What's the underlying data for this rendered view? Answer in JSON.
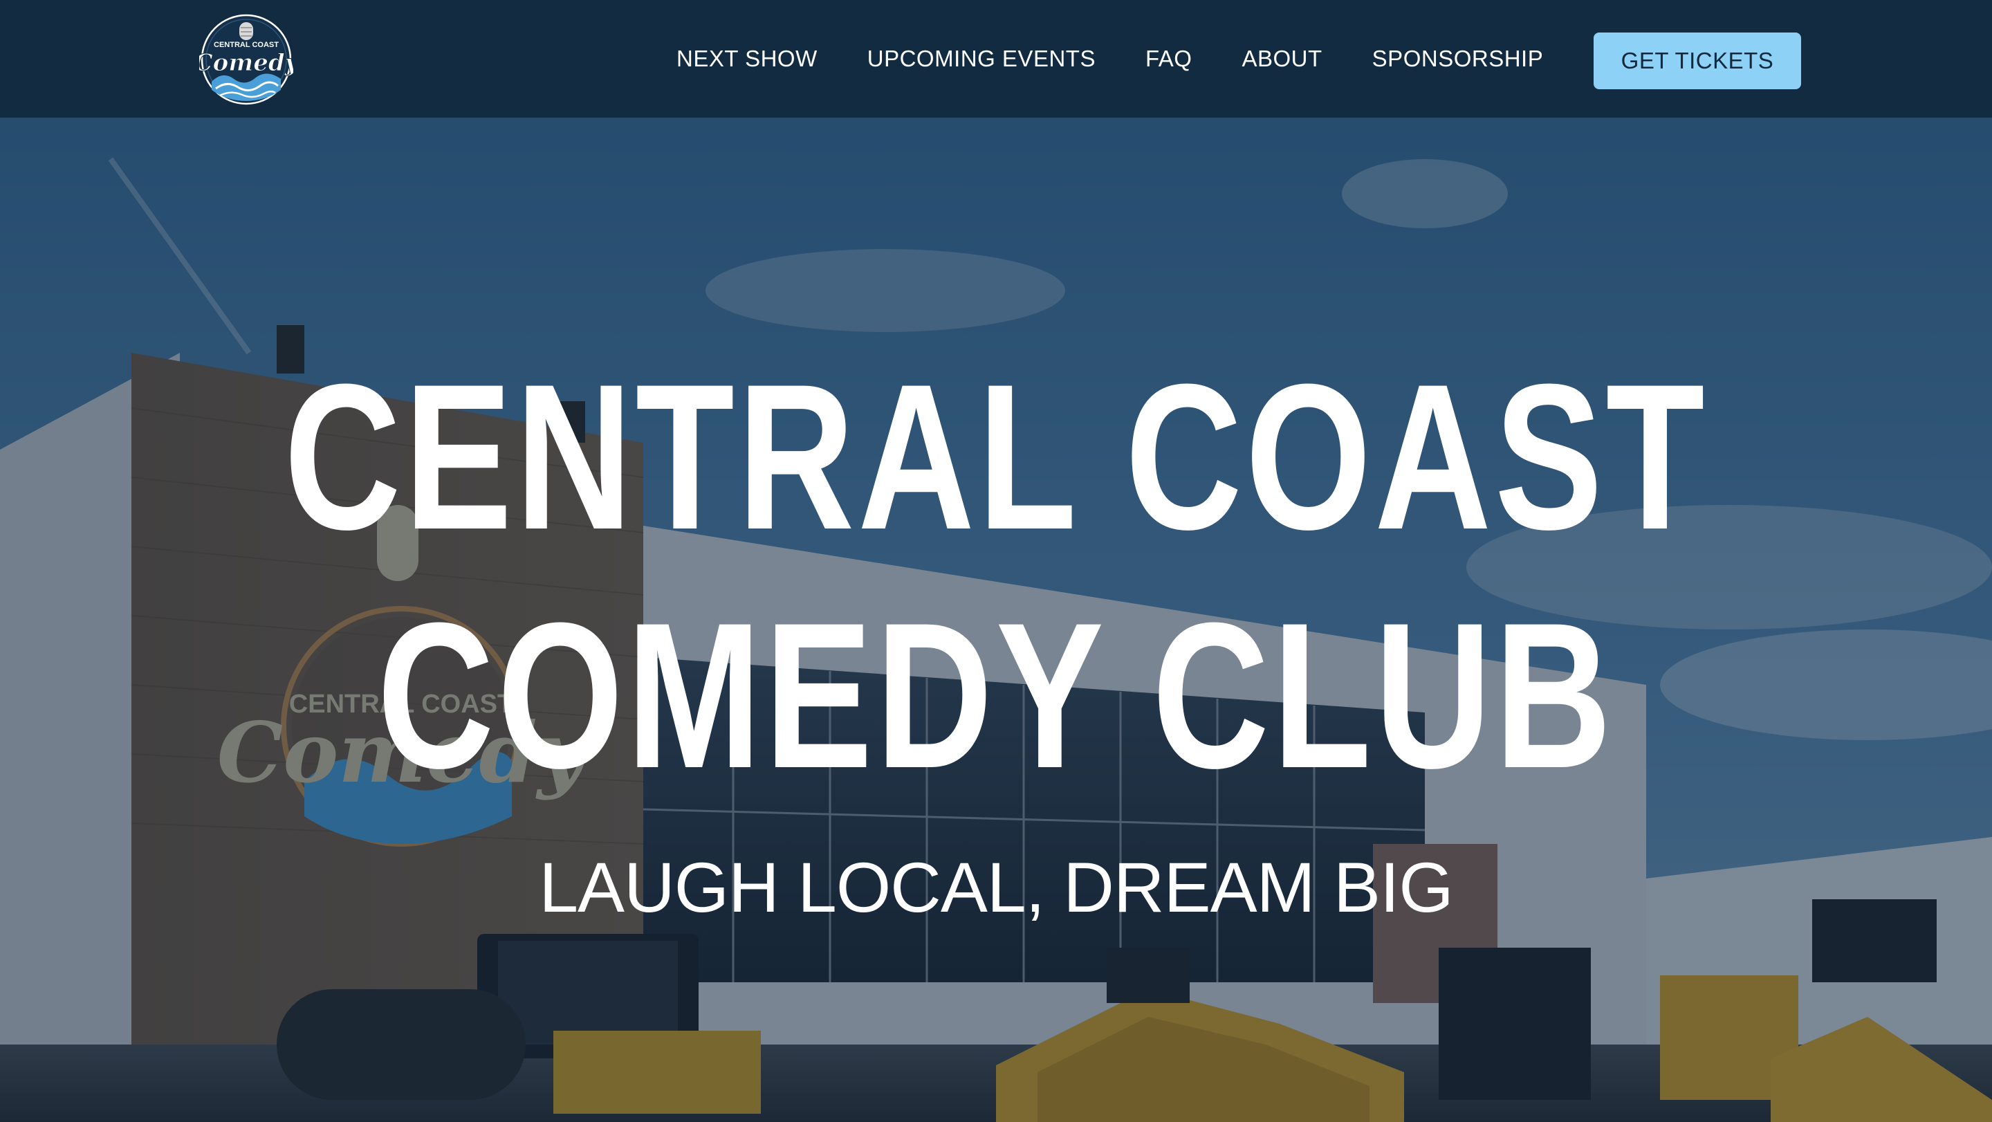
{
  "nav": {
    "logo": {
      "text_top": "CENTRAL COAST",
      "text_main": "Comedy",
      "icon": "microphone-wave-icon"
    },
    "links": [
      {
        "label": "NEXT SHOW"
      },
      {
        "label": "UPCOMING EVENTS"
      },
      {
        "label": "FAQ"
      },
      {
        "label": "ABOUT"
      },
      {
        "label": "SPONSORSHIP"
      }
    ],
    "cta_label": "GET TICKETS"
  },
  "hero": {
    "title_line1": "CENTRAL COAST",
    "title_line2": "COMEDY CLUB",
    "subtitle": "LAUGH LOCAL, DREAM BIG",
    "wall_logo": {
      "text_top": "CENTRAL COAST",
      "text_main": "Comedy"
    }
  },
  "colors": {
    "nav_bg": "#122b40",
    "cta_bg": "#8ed1f6",
    "cta_text": "#12283c",
    "hero_text": "#ffffff",
    "logo_blue": "#4a9fd8",
    "logo_tan": "#cfc3a0"
  }
}
